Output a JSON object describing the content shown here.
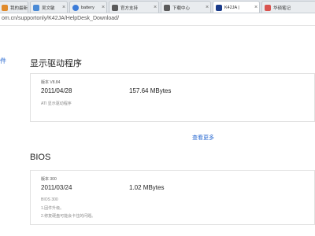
{
  "tabs": [
    {
      "title": "我的最新",
      "icon": "page-icon",
      "color": "#e08a2b",
      "active": false
    },
    {
      "title": "吴文敏",
      "icon": "page-icon",
      "color": "#4a8ad6",
      "active": false
    },
    {
      "title": "battery",
      "icon": "search-icon",
      "color": "#3b7bd8",
      "active": false
    },
    {
      "title": "官方支持",
      "icon": "page-icon",
      "color": "#5a5a5a",
      "active": false
    },
    {
      "title": "下载中心",
      "icon": "page-icon",
      "color": "#5a5a5a",
      "active": false
    },
    {
      "title": "K42JA |",
      "icon": "asus-icon",
      "color": "#1a3b8a",
      "active": true
    },
    {
      "title": "华硕笔记",
      "icon": "zhihu-icon",
      "color": "#d9534f",
      "active": false
    }
  ],
  "address": {
    "url": "om.cn/supportonly/K42JA/HelpDesk_Download/"
  },
  "side": {
    "fragment": "件"
  },
  "sections": {
    "display": {
      "title": "显示驱动程序",
      "version": "版本 V8.84",
      "date": "2011/04/28",
      "size": "157.64 MBytes",
      "desc": "ATI 显示驱动程序"
    },
    "more": "查看更多",
    "bios": {
      "title": "BIOS",
      "version": "版本 300",
      "date": "2011/03/24",
      "size": "1.02 MBytes",
      "desc1": "BIOS 300",
      "desc2": "1.固件升级。",
      "desc3": "2.修复硬盘可能会卡住的问题。"
    }
  }
}
